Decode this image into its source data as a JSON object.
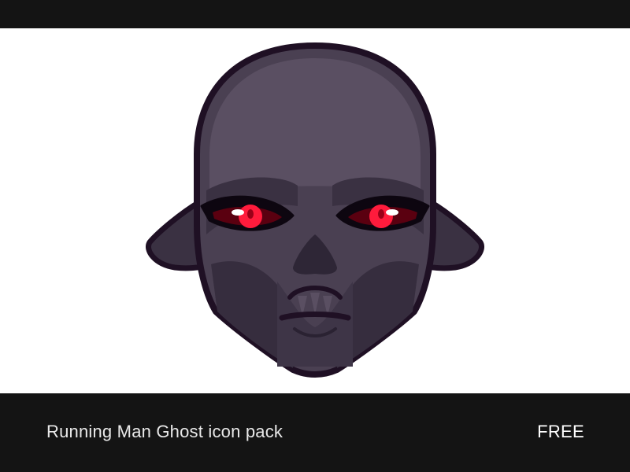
{
  "footer": {
    "title": "Running Man Ghost icon pack",
    "badge": "FREE"
  },
  "colors": {
    "bar": "#141414",
    "canvas": "#ffffff",
    "outline": "#1f1024",
    "skin_light": "#5a4f62",
    "skin_mid": "#4a4052",
    "skin_dark": "#3a3142",
    "eye_red": "#ff1b3c",
    "eye_dark_red": "#6a0010"
  },
  "icon": {
    "name": "ghost-head-icon"
  }
}
